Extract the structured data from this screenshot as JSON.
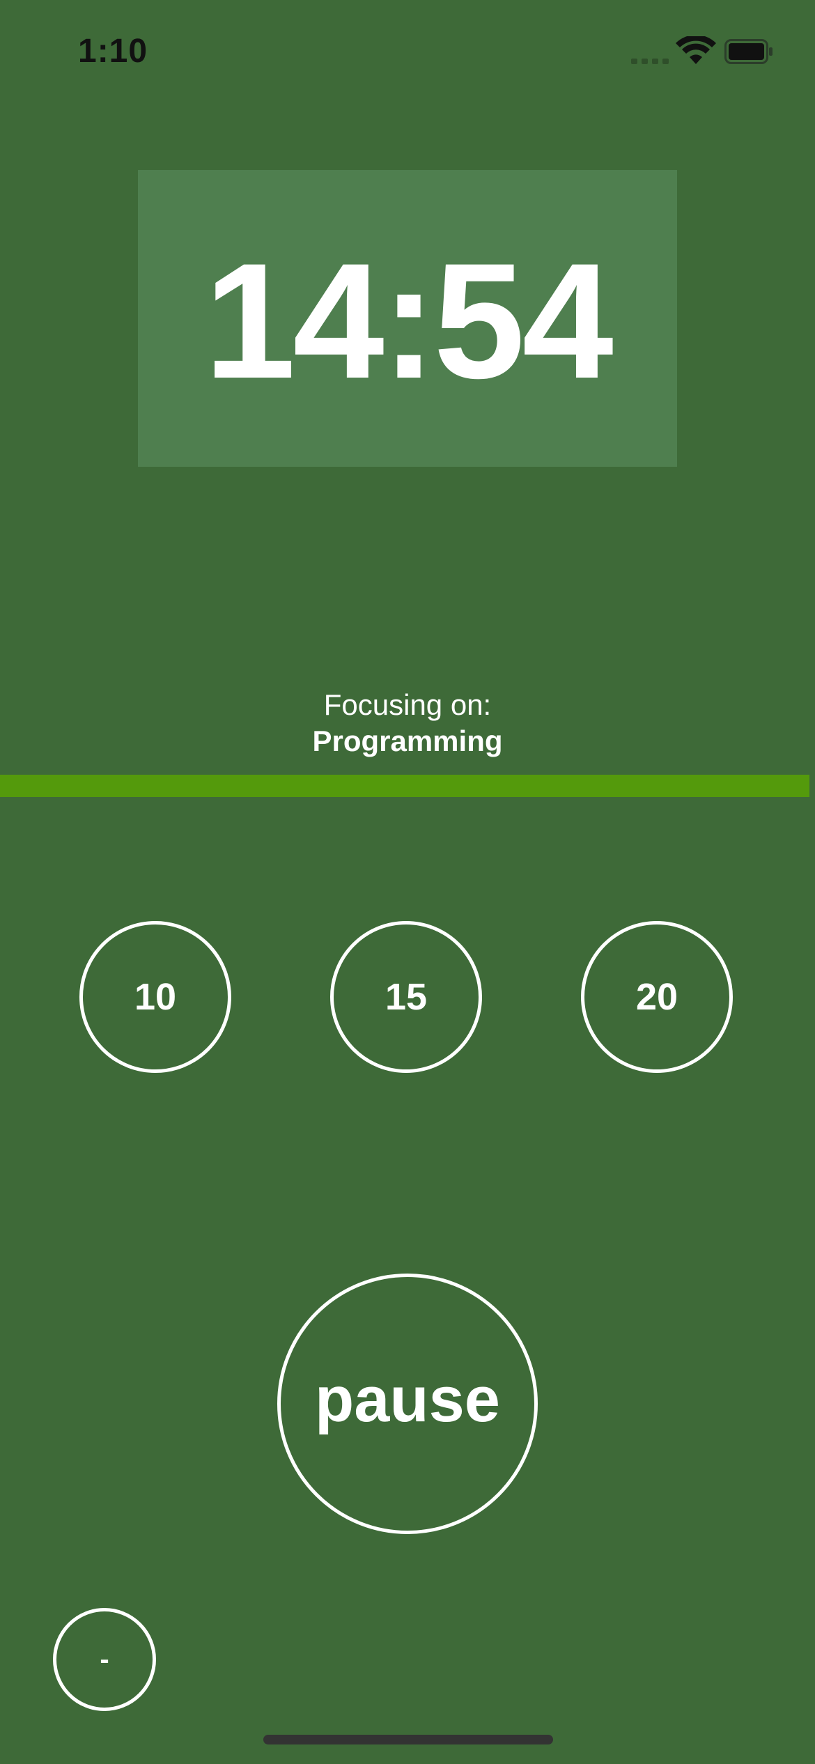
{
  "status_bar": {
    "time": "1:10"
  },
  "timer": {
    "display": "14:54"
  },
  "focus": {
    "label": "Focusing on:",
    "task": "Programming"
  },
  "progress": {
    "fraction": 0.993,
    "color": "#549a0c"
  },
  "presets": [
    {
      "label": "10"
    },
    {
      "label": "15"
    },
    {
      "label": "20"
    }
  ],
  "controls": {
    "pause_label": "pause",
    "minus_label": "-"
  },
  "colors": {
    "background": "#3e6a38",
    "timer_card": "#4f7f4f",
    "foreground": "#ffffff"
  },
  "icons": [
    "cellular-signal-icon",
    "wifi-icon",
    "battery-icon"
  ]
}
